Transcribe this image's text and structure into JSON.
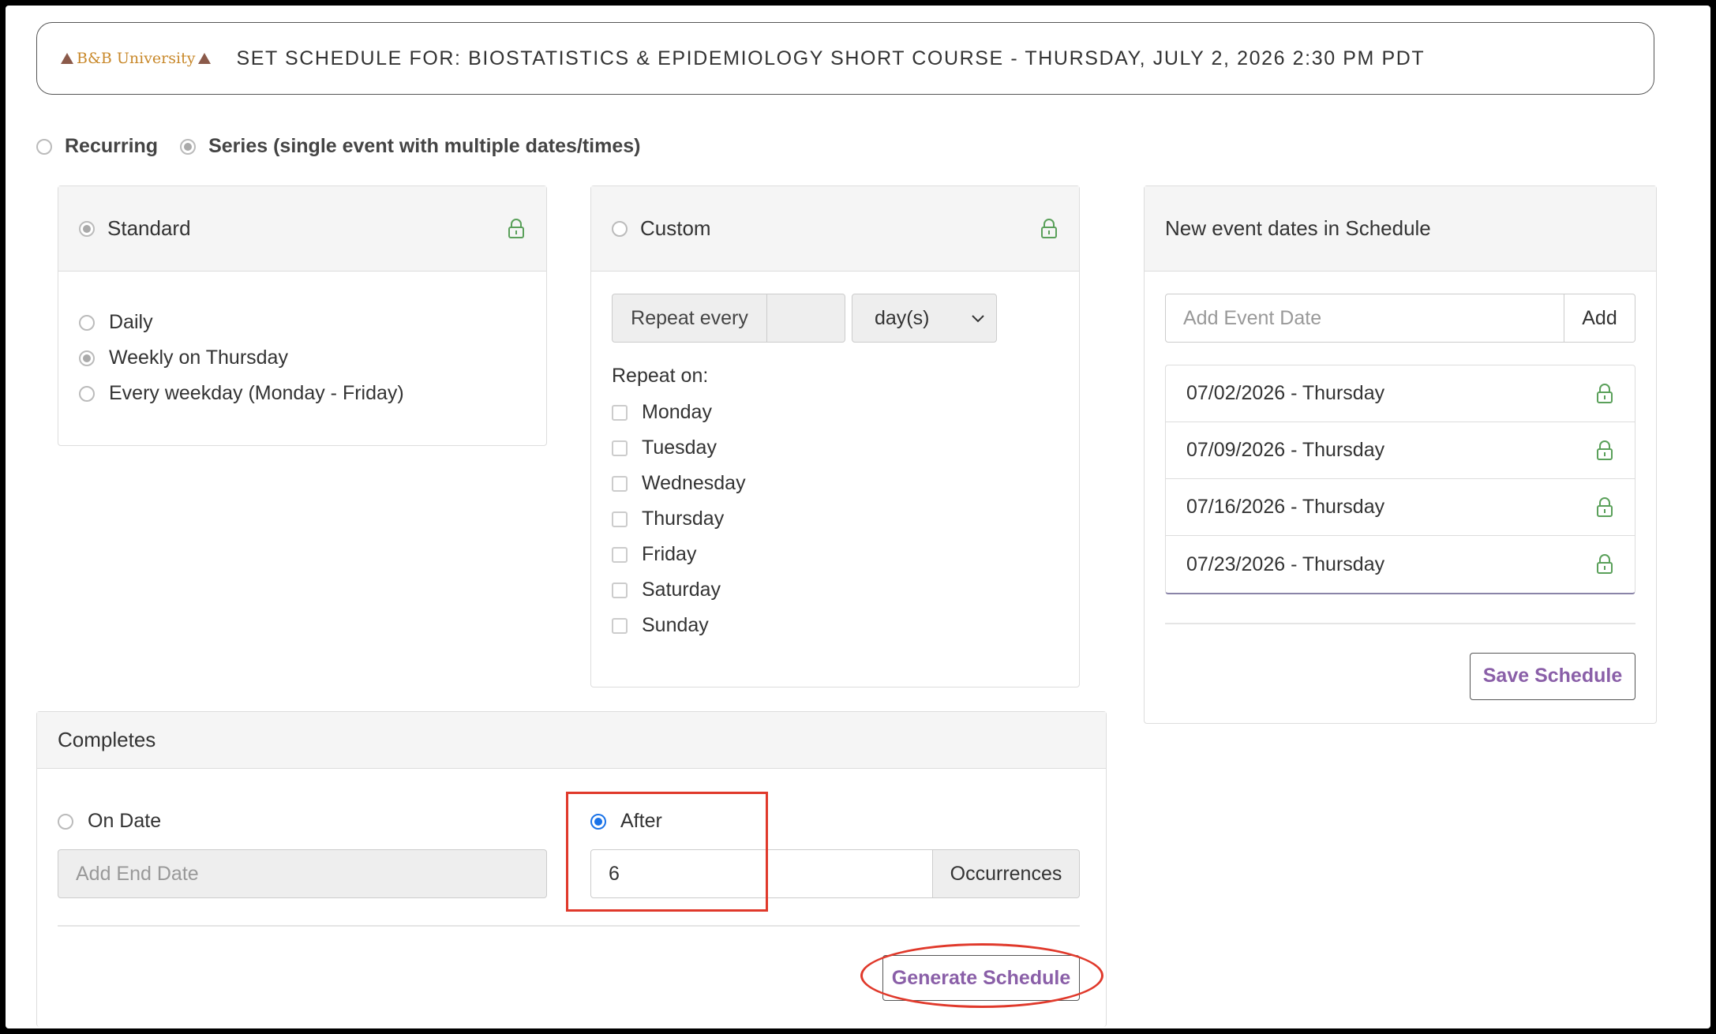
{
  "header": {
    "logo_text": "B&B University",
    "title": "SET SCHEDULE FOR: BIOSTATISTICS & EPIDEMIOLOGY SHORT COURSE - THURSDAY, JULY 2, 2026 2:30 PM PDT"
  },
  "mode": {
    "recurring_label": "Recurring",
    "series_label": "Series (single event with multiple dates/times)"
  },
  "standard": {
    "title": "Standard",
    "options": [
      "Daily",
      "Weekly on Thursday",
      "Every weekday (Monday - Friday)"
    ]
  },
  "custom": {
    "title": "Custom",
    "repeat_every_label": "Repeat every",
    "repeat_every_value": "",
    "unit_selected": "day(s)",
    "repeat_on_label": "Repeat on:",
    "days": [
      "Monday",
      "Tuesday",
      "Wednesday",
      "Thursday",
      "Friday",
      "Saturday",
      "Sunday"
    ]
  },
  "schedule": {
    "title": "New event dates in Schedule",
    "add_placeholder": "Add Event Date",
    "add_button": "Add",
    "dates": [
      "07/02/2026 - Thursday",
      "07/09/2026 - Thursday",
      "07/16/2026 - Thursday",
      "07/23/2026 - Thursday"
    ],
    "save_button": "Save Schedule"
  },
  "completes": {
    "title": "Completes",
    "on_date_label": "On Date",
    "end_date_placeholder": "Add End Date",
    "after_label": "After",
    "occurrences_value": "6",
    "occurrences_label": "Occurrences",
    "generate_button": "Generate Schedule"
  },
  "colors": {
    "accent_purple": "#8a5fa8",
    "lock_green": "#5aa05a",
    "annotation_red": "#e0392b",
    "radio_blue": "#1a73e8"
  }
}
